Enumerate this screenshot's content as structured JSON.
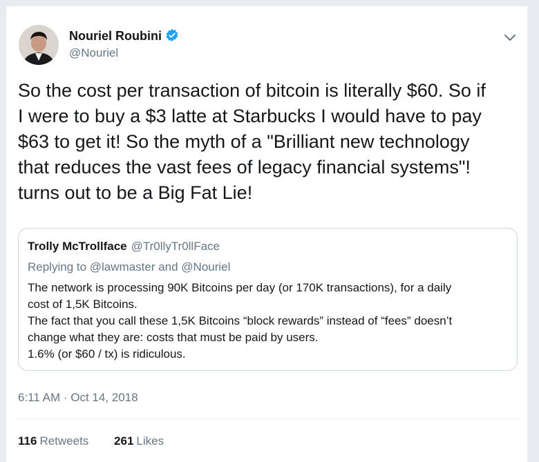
{
  "author": {
    "name": "Nouriel Roubini",
    "handle": "@Nouriel",
    "verified_color": "#1da1f2"
  },
  "tweet": {
    "text": "So the cost per transaction of bitcoin is literally $60. So if\nI were to buy a $3 latte at Starbucks I would have to pay\n$63 to get it!  So the myth of a \"Brilliant new technology\nthat reduces the vast fees of legacy financial systems\"!\nturns out to be a Big Fat Lie!"
  },
  "quoted_tweet": {
    "name": "Trolly McTrollface",
    "handle": "@Tr0llyTr0llFace",
    "replying_to": "Replying to @lawmaster and @Nouriel",
    "text": "The network is processing 90K Bitcoins per day (or 170K transactions), for a daily\ncost of 1,5K Bitcoins.\nThe fact that you call these 1,5K Bitcoins “block rewards” instead of “fees” doesn’t\nchange what they are: costs that must be paid by users.\n1.6% (or $60 / tx) is ridiculous."
  },
  "timestamp": "6:11 AM · Oct 14, 2018",
  "stats": {
    "retweets_count": "116",
    "retweets_label": "Retweets",
    "likes_count": "261",
    "likes_label": "Likes"
  },
  "icons": {
    "caret": "chevron-down-icon",
    "verified": "verified-badge-icon"
  }
}
